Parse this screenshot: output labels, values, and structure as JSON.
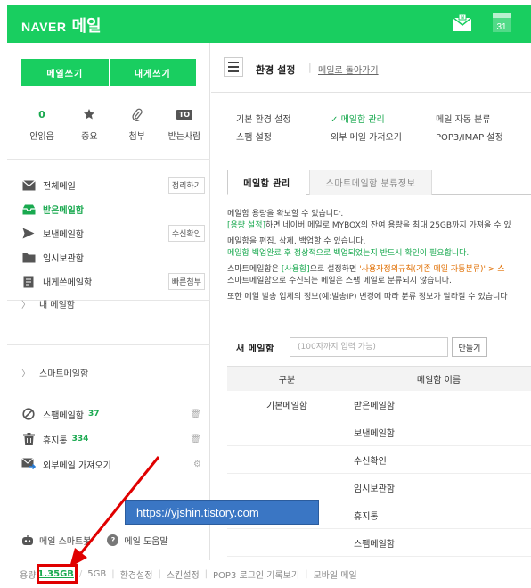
{
  "header": {
    "brand": "NAVER",
    "product": "메일",
    "bg_color": "#19ce60",
    "calendar_day": "31"
  },
  "sidebar": {
    "compose_label": "메일쓰기",
    "self_compose_label": "내게쓰기",
    "quick": [
      {
        "value": "0",
        "label": "안읽음",
        "icon": "unread-count"
      },
      {
        "value": "★",
        "label": "중요",
        "icon": "star-icon"
      },
      {
        "value": "📎",
        "label": "첨부",
        "icon": "paperclip-icon"
      },
      {
        "value": "TO",
        "label": "받는사람",
        "icon": "to-badge-icon"
      }
    ],
    "folders": [
      {
        "label": "전체메일",
        "action": "정리하기",
        "icon": "all-mail-icon"
      },
      {
        "label": "받은메일함",
        "action": "",
        "icon": "inbox-icon",
        "active": true
      },
      {
        "label": "보낸메일함",
        "action": "수신확인",
        "icon": "sent-icon"
      },
      {
        "label": "임시보관함",
        "action": "",
        "icon": "draft-folder-icon"
      },
      {
        "label": "내게쓴메일함",
        "action": "빠른첨부",
        "icon": "note-icon"
      }
    ],
    "my_folders": "내 메일함",
    "smart_folders": "스마트메일함",
    "spam": {
      "label": "스팸메일함",
      "count": "37"
    },
    "trash": {
      "label": "휴지통",
      "count": "334"
    },
    "external": {
      "label": "외부메일 가져오기"
    },
    "bot_label": "메일 스마트봇",
    "help_label": "메일 도움말"
  },
  "footer": {
    "usage_label": "용량",
    "usage_used": "1.35GB",
    "usage_total": "5GB",
    "links": [
      "환경설정",
      "스킨설정",
      "POP3 로그인 기록보기",
      "모바일 메일"
    ]
  },
  "main": {
    "title": "환경 설정",
    "back_link": "메일로 돌아가기",
    "nav": {
      "row1": [
        "기본 환경 설정",
        "메일함 관리",
        "메일 자동 분류"
      ],
      "row2": [
        "스팸 설정",
        "외부 메일 가져오기",
        "POP3/IMAP 설정"
      ],
      "active_check": "✓"
    },
    "tabs": [
      "메일함 관리",
      "스마트메일함 분류정보"
    ],
    "desc": {
      "l1": "메일함 용량을 확보할 수 있습니다.",
      "l2a": "[용량 설정]",
      "l2b": "하면 네이버 메일로 MYBOX의 잔여 용량을 최대 25GB까지 가져올 수 있",
      "l3": "메일함을 편집, 삭제, 백업할 수 있습니다.",
      "l4": "메일함 백업완료 후 정상적으로 백업되었는지 반드시 확인이 필요합니다.",
      "l5a": "스마트메일함은 ",
      "l5b": "[사용함]",
      "l5c": "으로 설정하면 ",
      "l5d": "'사용자정의규칙(기존 메일 자동분류)'",
      "l5e": " > 스",
      "l6": "스마트메일함으로 수신되는 메일은 스팸 메일로 분류되지 않습니다.",
      "l7": "또한 메일 발송 업체의 정보(예:발송IP) 변경에 따라 분류 정보가 달라질 수 있습니다"
    },
    "new_folder": {
      "label": "새 메일함",
      "placeholder": "(100자까지 입력 가능)",
      "button": "만들기"
    },
    "table": {
      "headers": [
        "구분",
        "메일함 이름"
      ],
      "group": "기본메일함",
      "rows": [
        "받은메일함",
        "보낸메일함",
        "수신확인",
        "임시보관함",
        "휴지통",
        "스팸메일함"
      ]
    }
  },
  "overlay": {
    "watermark": "https://yjshin.tistory.com",
    "annotation_color": "#e00000"
  }
}
